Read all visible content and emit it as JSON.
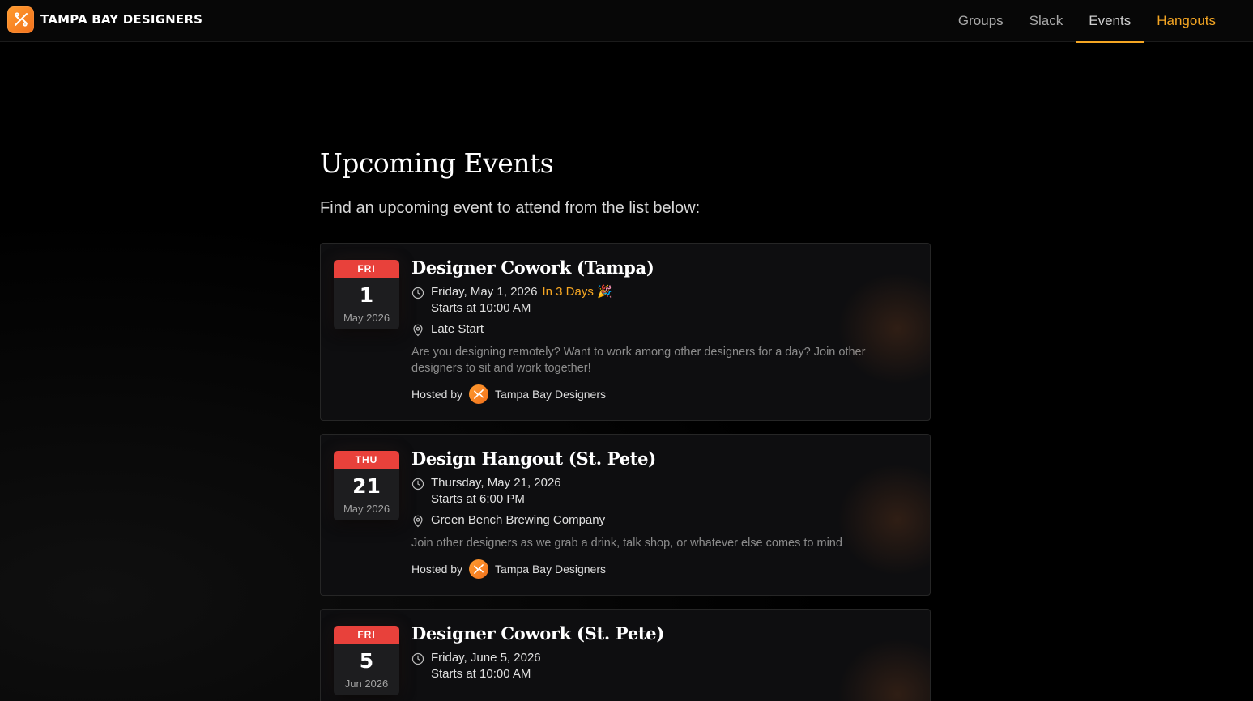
{
  "header": {
    "brand": "TAMPA BAY DESIGNERS",
    "logo_icon": "tbd-logo-icon",
    "nav": [
      {
        "label": "Groups",
        "state": "default"
      },
      {
        "label": "Slack",
        "state": "default"
      },
      {
        "label": "Events",
        "state": "active"
      },
      {
        "label": "Hangouts",
        "state": "accent"
      }
    ]
  },
  "main": {
    "title": "Upcoming Events",
    "subtitle": "Find an upcoming event to attend from the list below:"
  },
  "events": [
    {
      "cal_dow": "FRI",
      "cal_day": "1",
      "cal_month": "May 2026",
      "title": "Designer Cowork (Tampa)",
      "date": "Friday, May 1, 2026",
      "relative": "In 3 Days 🎉",
      "time": "Starts at 10:00 AM",
      "location": "Late Start",
      "description": "Are you designing remotely? Want to work among other designers for a day? Join other designers to sit and work together!",
      "hosted_by_label": "Hosted by",
      "host": "Tampa Bay Designers"
    },
    {
      "cal_dow": "THU",
      "cal_day": "21",
      "cal_month": "May 2026",
      "title": "Design Hangout (St. Pete)",
      "date": "Thursday, May 21, 2026",
      "relative": "",
      "time": "Starts at 6:00 PM",
      "location": "Green Bench Brewing Company",
      "description": "Join other designers as we grab a drink, talk shop, or whatever else comes to mind",
      "hosted_by_label": "Hosted by",
      "host": "Tampa Bay Designers"
    },
    {
      "cal_dow": "FRI",
      "cal_day": "5",
      "cal_month": "Jun 2026",
      "title": "Designer Cowork (St. Pete)",
      "date": "Friday, June 5, 2026",
      "relative": "",
      "time": "Starts at 10:00 AM"
    }
  ],
  "colors": {
    "accent": "#f5a623",
    "calendar_red": "#e8413b",
    "brand_orange": "#f2711c"
  }
}
